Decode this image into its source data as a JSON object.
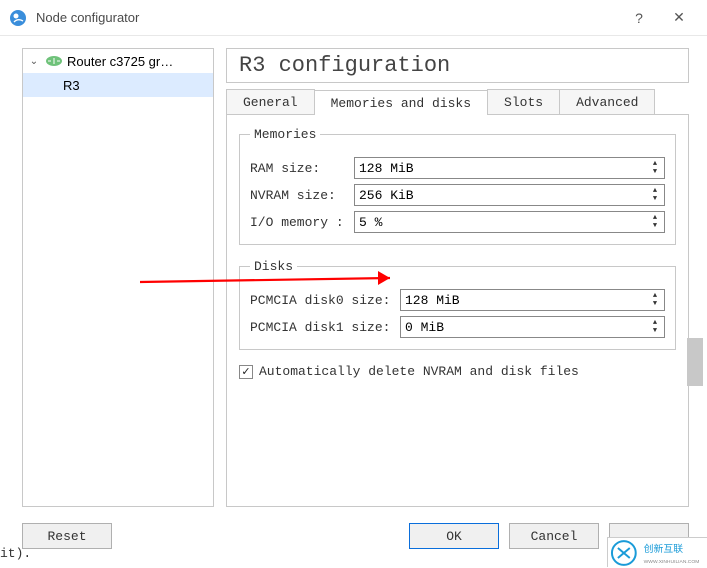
{
  "window": {
    "title": "Node configurator",
    "help": "?",
    "close": "✕"
  },
  "tree": {
    "root_label": "Router c3725 gr…",
    "child_label": "R3"
  },
  "header": {
    "title": "R3 configuration"
  },
  "tabs": {
    "general": "General",
    "memories": "Memories and disks",
    "slots": "Slots",
    "advanced": "Advanced"
  },
  "memories": {
    "legend": "Memories",
    "ram_label": "RAM size:",
    "ram_value": "128 MiB",
    "nvram_label": "NVRAM size:",
    "nvram_value": "256 KiB",
    "io_label": "I/O memory :",
    "io_value": "5 %"
  },
  "disks": {
    "legend": "Disks",
    "d0_label": "PCMCIA disk0 size:",
    "d0_value": "128 MiB",
    "d1_label": "PCMCIA disk1 size:",
    "d1_value": "0 MiB"
  },
  "checkbox": {
    "label": "Automatically delete NVRAM and disk files"
  },
  "buttons": {
    "reset": "Reset",
    "ok": "OK",
    "cancel": "Cancel"
  },
  "fragment": "it)."
}
